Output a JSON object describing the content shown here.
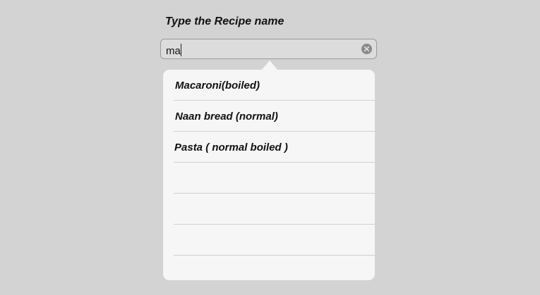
{
  "header": {
    "title": "Type the Recipe name"
  },
  "search": {
    "value": "ma"
  },
  "icons": {
    "clear": "clear-circle-icon"
  },
  "suggestions": [
    {
      "label": "Macaroni(boiled)"
    },
    {
      "label": "Naan bread (normal)"
    },
    {
      "label": "Pasta ( normal boiled )"
    },
    {
      "label": ""
    },
    {
      "label": ""
    },
    {
      "label": ""
    },
    {
      "label": ""
    }
  ]
}
